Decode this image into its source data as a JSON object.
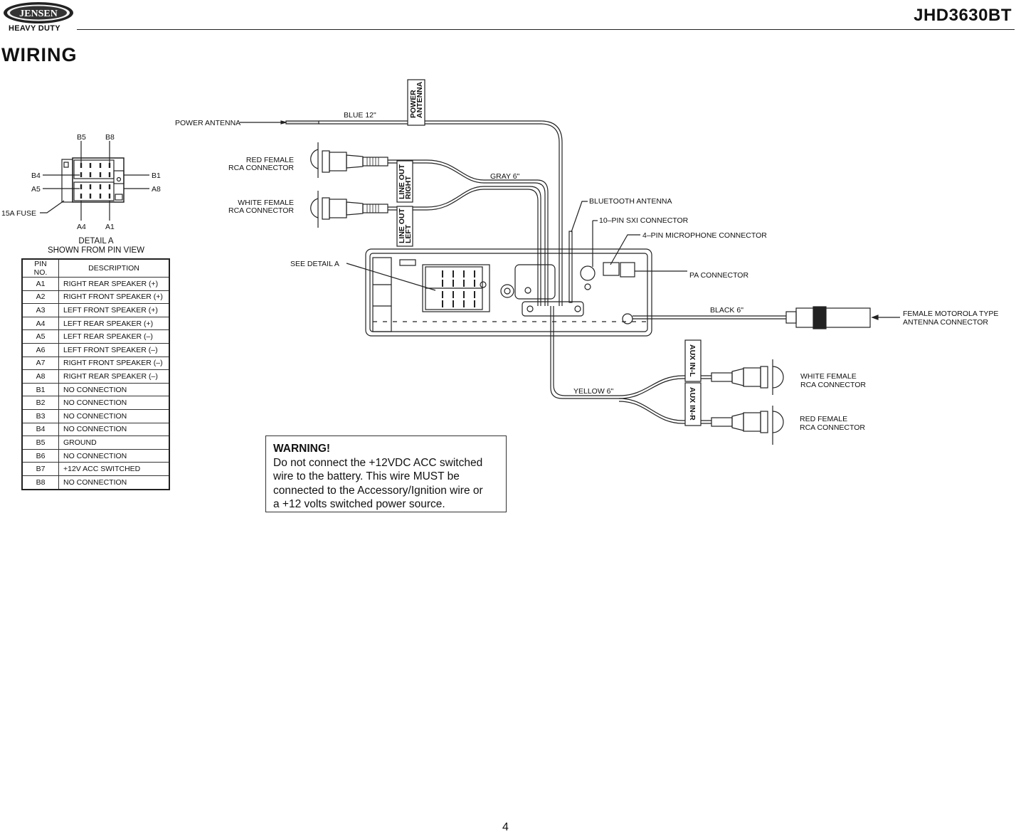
{
  "header": {
    "brand": "JENSEN",
    "brand_sub": "HEAVY DUTY",
    "model": "JHD3630BT"
  },
  "section_title": "WIRING",
  "detail_a": {
    "pin_labels": {
      "b5": "B5",
      "b8": "B8",
      "b4": "B4",
      "b1": "B1",
      "a5": "A5",
      "a8": "A8",
      "a4": "A4",
      "a1": "A1"
    },
    "fuse_label": "15A FUSE",
    "caption_line1": "DETAIL  A",
    "caption_line2": "SHOWN  FROM  PIN  VIEW"
  },
  "pin_table": {
    "headers": [
      "PIN  NO.",
      "DESCRIPTION"
    ],
    "rows": [
      {
        "pin": "A1",
        "desc": "RIGHT  REAR  SPEAKER  (+)"
      },
      {
        "pin": "A2",
        "desc": "RIGHT  FRONT  SPEAKER  (+)"
      },
      {
        "pin": "A3",
        "desc": "LEFT  FRONT  SPEAKER  (+)"
      },
      {
        "pin": "A4",
        "desc": "LEFT  REAR  SPEAKER  (+)"
      },
      {
        "pin": "A5",
        "desc": "LEFT  REAR  SPEAKER  (–)"
      },
      {
        "pin": "A6",
        "desc": "LEFT  FRONT  SPEAKER  (–)"
      },
      {
        "pin": "A7",
        "desc": "RIGHT  FRONT  SPEAKER  (–)"
      },
      {
        "pin": "A8",
        "desc": "RIGHT  REAR  SPEAKER  (–)"
      },
      {
        "pin": "B1",
        "desc": "NO  CONNECTION"
      },
      {
        "pin": "B2",
        "desc": "NO  CONNECTION"
      },
      {
        "pin": "B3",
        "desc": "NO  CONNECTION"
      },
      {
        "pin": "B4",
        "desc": "NO  CONNECTION"
      },
      {
        "pin": "B5",
        "desc": "GROUND"
      },
      {
        "pin": "B6",
        "desc": "NO  CONNECTION"
      },
      {
        "pin": "B7",
        "desc": "+12V  ACC  SWITCHED"
      },
      {
        "pin": "B8",
        "desc": "NO  CONNECTION"
      }
    ]
  },
  "callouts": {
    "power_antenna": "POWER  ANTENNA",
    "blue_wire": "BLUE  12\"",
    "power_antenna_tag_1": "POWER",
    "power_antenna_tag_2": "ANTENNA",
    "red_rca_1": "RED  FEMALE",
    "red_rca_2": "RCA  CONNECTOR",
    "white_rca_1": "WHITE  FEMALE",
    "white_rca_2": "RCA  CONNECTOR",
    "line_out_right_1": "LINE OUT",
    "line_out_right_2": "RIGHT",
    "line_out_left_1": "LINE OUT",
    "line_out_left_2": "LEFT",
    "gray_wire": "GRAY  6\"",
    "bluetooth_antenna": "BLUETOOTH  ANTENNA",
    "sxi_connector": "10–PIN  SXI  CONNECTOR",
    "mic_connector": "4–PIN  MICROPHONE  CONNECTOR",
    "pa_connector": "PA  CONNECTOR",
    "see_detail": "SEE  DETAIL  A",
    "black_wire": "BLACK  6\"",
    "motorola_1": "FEMALE  MOTOROLA  TYPE",
    "motorola_2": "ANTENNA  CONNECTOR",
    "aux_in_l": "AUX IN-L",
    "aux_in_r": "AUX IN-R",
    "yellow_wire": "YELLOW  6\"",
    "aux_white_1": "WHITE  FEMALE",
    "aux_white_2": "RCA  CONNECTOR",
    "aux_red_1": "RED  FEMALE",
    "aux_red_2": "RCA  CONNECTOR"
  },
  "warning": {
    "title": "WARNING!",
    "line1": "Do not connect the +12VDC ACC switched",
    "line2": "wire to the battery. This wire MUST be",
    "line3": "connected to the Accessory/Ignition wire or",
    "line4": "a +12 volts switched power source."
  },
  "page_number": "4"
}
